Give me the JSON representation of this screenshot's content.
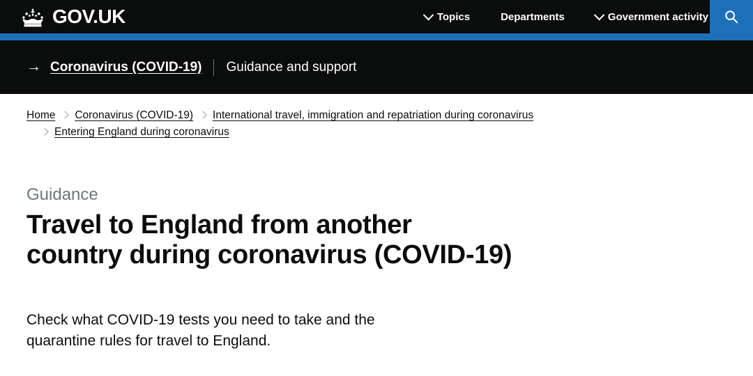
{
  "header": {
    "brand_name": "GOV.UK",
    "crown_icon": "crown-icon",
    "nav": [
      {
        "label": "Topics",
        "has_chevron": true
      },
      {
        "label": "Departments",
        "has_chevron": false
      },
      {
        "label": "Government activity",
        "has_chevron": true
      }
    ],
    "search": {
      "icon": "search-icon",
      "aria_label": "Search",
      "background_color": "#1d70b8"
    },
    "background_color": "#0b0c0c",
    "blue_rule_color": "#1d70b8"
  },
  "covid_banner": {
    "arrow": "→",
    "link_label": "Coronavirus (COVID-19)",
    "divider": "|",
    "sub_label": "Guidance and support",
    "background_color": "#0b0c0c"
  },
  "breadcrumbs": {
    "line1": [
      {
        "label": "Home"
      },
      {
        "label": "Coronavirus (COVID-19)"
      },
      {
        "label": "International travel, immigration and repatriation during coronavirus"
      }
    ],
    "line2": [
      {
        "label": "Entering England during coronavirus"
      }
    ]
  },
  "main": {
    "kicker": "Guidance",
    "title_line1": "Travel to England from another",
    "title_line2": "country during coronavirus (COVID-19)",
    "lede": "Check what COVID-19 tests you need to take and the quarantine rules for travel to England."
  }
}
